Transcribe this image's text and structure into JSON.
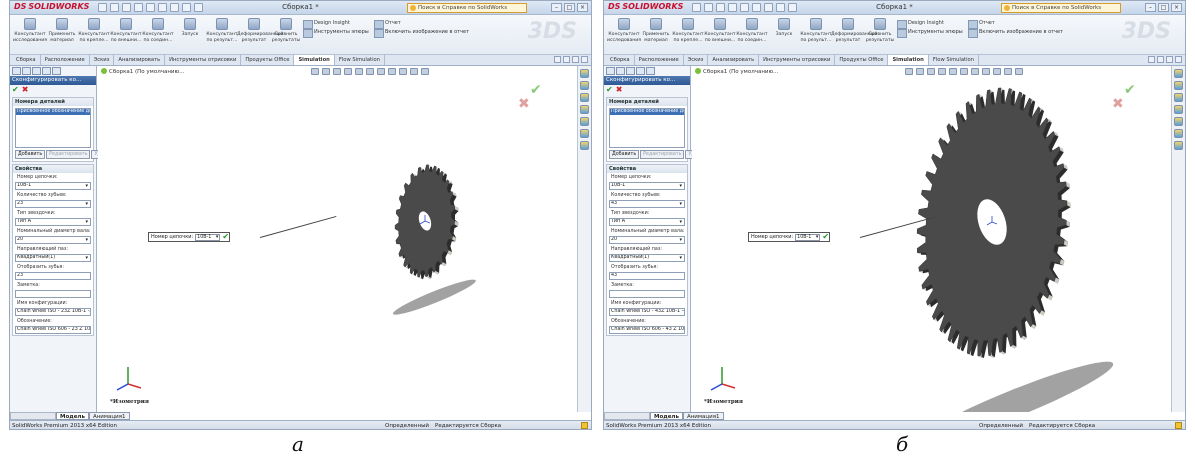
{
  "panels": [
    {
      "caption": "а",
      "app": {
        "logo": "SOLIDWORKS",
        "doc_title": "Сборка1 *",
        "help_search": "Поиск в Справке по SolidWorks"
      },
      "ribbon": {
        "buttons": [
          "Консультант исследования",
          "Применить материал",
          "Консультант по крепле...",
          "Консультант по внешни...",
          "Консультант по соедин...",
          "Запуск",
          "Консультант по результ...",
          "Деформированный результат",
          "Сравнить результаты"
        ],
        "list1": [
          "Design Insight",
          "Инструменты эпюры"
        ],
        "list2": [
          "Отчет",
          "Включить изображение в отчет"
        ]
      },
      "tabs": [
        "Сборка",
        "Расположение",
        "Эскиз",
        "Анализировать",
        "Инструменты отрисовки",
        "Продукты Office",
        "Simulation",
        "Flow Simulation"
      ],
      "tree_label": "Сборка1 (По умолчанию...",
      "property_manager": {
        "title": "Сконфигурировать ко...",
        "group1_title": "Номера деталей",
        "list_selected": "Присвоенное обозначение детали",
        "btn_add": "Добавить",
        "btn_edit": "Редактировать",
        "btn_del": "Уд",
        "group2_title": "Свойства",
        "chain_label": "Номер цепочки:",
        "chain_value": "10B-1",
        "teeth_label": "Количество зубьев:",
        "teeth_value": "23",
        "type_label": "Тип звездочки:",
        "type_value": "Тип A",
        "shaft_label": "Номинальный диаметр вала:",
        "shaft_value": "20",
        "keyway_label": "Направляющий паз:",
        "keyway_value": "Квадратный(1)",
        "show_teeth_label": "Отобразить зубья:",
        "show_teeth_value": "23",
        "comment_label": "Заметка:",
        "comment_value": "",
        "config_label": "Имя конфигурации:",
        "config_value": "Chain wheel ISO - 23Z 10B-1 -23",
        "designation_label": "Обозначение:",
        "designation_value": "Chain wheel ISO 606 - 23 Z 10B-1"
      },
      "callout": {
        "label": "Номер цепочки:",
        "value": "10B-1"
      },
      "view_label": "*Изометрия",
      "bottom_tabs": [
        "Модель",
        "Анимация1"
      ],
      "status": {
        "left": "SolidWorks Premium 2013 x64 Edition",
        "state": "Определенный",
        "mode": "Редактируется Сборка"
      },
      "sprocket": {
        "teeth": 23
      }
    },
    {
      "caption": "б",
      "app": {
        "logo": "SOLIDWORKS",
        "doc_title": "Сборка1 *",
        "help_search": "Поиск в Справке по SolidWorks"
      },
      "ribbon": {
        "buttons": [
          "Консультант исследования",
          "Применить материал",
          "Консультант по крепле...",
          "Консультант по внешни...",
          "Консультант по соедин...",
          "Запуск",
          "Консультант по результ...",
          "Деформированный результат",
          "Сравнить результаты"
        ],
        "list1": [
          "Design Insight",
          "Инструменты эпюры"
        ],
        "list2": [
          "Отчет",
          "Включить изображение в отчет"
        ]
      },
      "tabs": [
        "Сборка",
        "Расположение",
        "Эскиз",
        "Анализировать",
        "Инструменты отрисовки",
        "Продукты Office",
        "Simulation",
        "Flow Simulation"
      ],
      "tree_label": "Сборка1 (По умолчанию...",
      "property_manager": {
        "title": "Сконфигурировать ко...",
        "group1_title": "Номера деталей",
        "list_selected": "Присвоенное обозначение детали",
        "btn_add": "Добавить",
        "btn_edit": "Редактировать",
        "btn_del": "Уд",
        "group2_title": "Свойства",
        "chain_label": "Номер цепочки:",
        "chain_value": "10B-1",
        "teeth_label": "Количество зубьев:",
        "teeth_value": "43",
        "type_label": "Тип звездочки:",
        "type_value": "Тип A",
        "shaft_label": "Номинальный диаметр вала:",
        "shaft_value": "20",
        "keyway_label": "Направляющий паз:",
        "keyway_value": "Квадратный(1)",
        "show_teeth_label": "Отобразить зубья:",
        "show_teeth_value": "43",
        "comment_label": "Заметка:",
        "comment_value": "",
        "config_label": "Имя конфигурации:",
        "config_value": "Chain wheel ISO - 43Z 10B-1 -43",
        "designation_label": "Обозначение:",
        "designation_value": "Chain wheel ISO 606 - 43 Z 10B-1"
      },
      "callout": {
        "label": "Номер цепочки:",
        "value": "10B-1"
      },
      "view_label": "*Изометрия",
      "bottom_tabs": [
        "Модель",
        "Анимация1"
      ],
      "status": {
        "left": "SolidWorks Premium 2013 x64 Edition",
        "state": "Определенный",
        "mode": "Редактируется Сборка"
      },
      "sprocket": {
        "teeth": 43
      }
    }
  ]
}
